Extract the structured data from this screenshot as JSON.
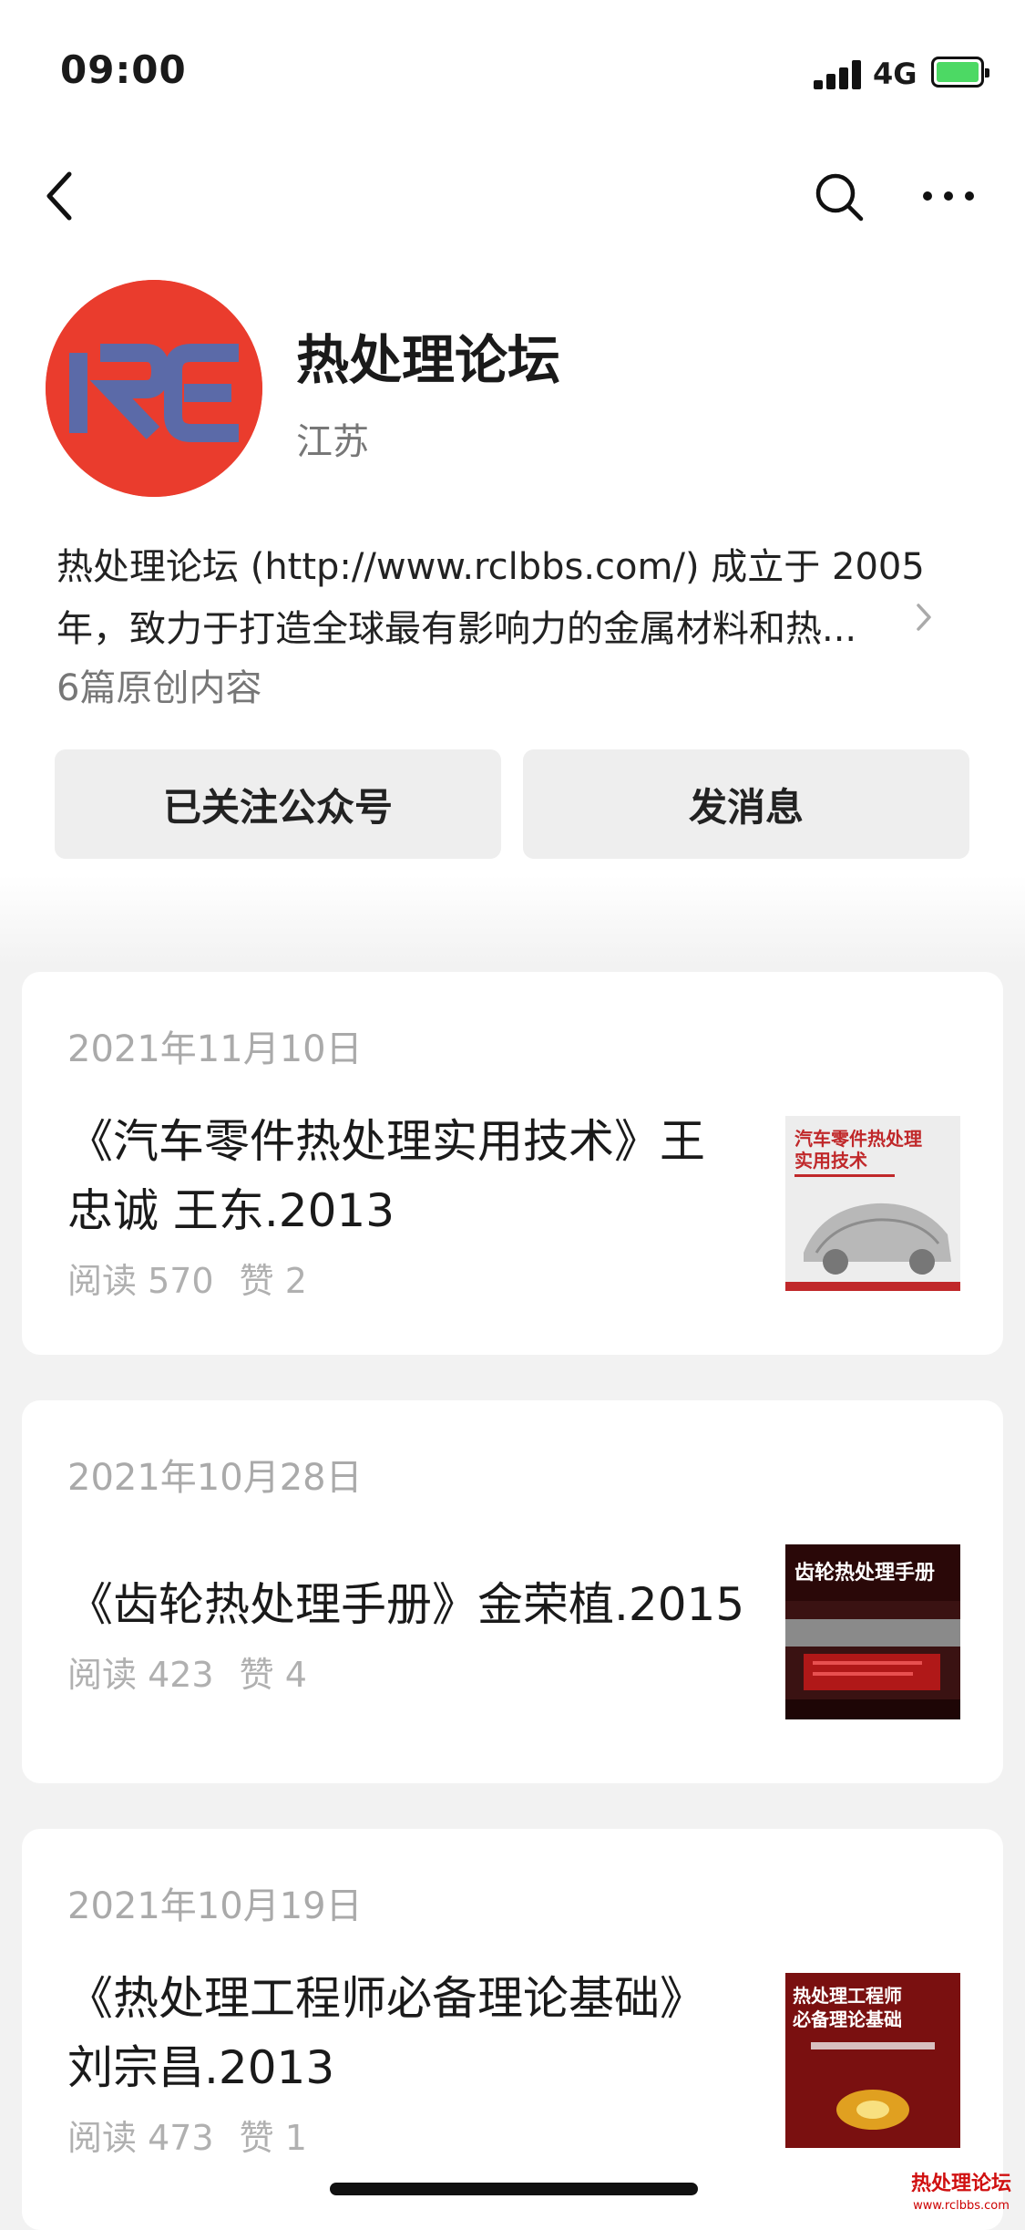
{
  "status_bar": {
    "time": "09:00",
    "network": "4G"
  },
  "account": {
    "logo_text": "RE",
    "name": "热处理论坛",
    "region": "江苏",
    "description_line1": "热处理论坛 (http://www.rclbbs.com/) 成立于 2005",
    "description_line2": "年，致力于打造全球最有影响力的金属材料和热...",
    "original_count": "6篇原创内容",
    "follow_label": "已关注公众号",
    "message_label": "发消息"
  },
  "articles": [
    {
      "date": "2021年11月10日",
      "title_line1": "《汽车零件热处理实用技术》王",
      "title_line2": "忠诚 王东.2013",
      "reads": "阅读 570",
      "likes": "赞 2",
      "cover_title1": "汽车零件热处理",
      "cover_title2": "实用技术"
    },
    {
      "date": "2021年10月28日",
      "title_line1": "《齿轮热处理手册》金荣植.2015",
      "reads": "阅读 423",
      "likes": "赞 4",
      "cover_title1": "齿轮热处理手册"
    },
    {
      "date": "2021年10月19日",
      "title_line1": "《热处理工程师必备理论基础》",
      "title_line2": "刘宗昌.2013",
      "reads": "阅读 473",
      "likes": "赞 1",
      "cover_title1": "热处理工程师",
      "cover_title2": "必备理论基础"
    }
  ],
  "watermark": {
    "line1": "热处理论坛",
    "line2": "www.rclbbs.com"
  },
  "colors": {
    "logo_red": "#ea3c2d",
    "logo_letters": "#5b6aa8",
    "meta_gray": "#b0b0b0"
  },
  "icons": [
    "back-icon",
    "search-icon",
    "more-icon",
    "chevron-right-icon",
    "signal-icon",
    "battery-icon"
  ]
}
